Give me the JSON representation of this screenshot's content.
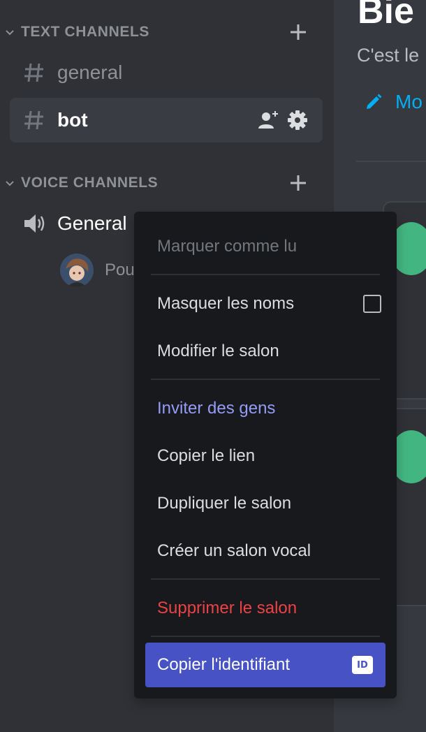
{
  "sidebar": {
    "text_category": {
      "label": "TEXT CHANNELS",
      "chevron_icon": "chevron-down-icon",
      "add_icon": "plus-icon"
    },
    "voice_category": {
      "label": "VOICE CHANNELS",
      "chevron_icon": "chevron-down-icon",
      "add_icon": "plus-icon"
    },
    "text_channels": [
      {
        "name": "general",
        "icon": "hashtag-icon",
        "selected": false
      },
      {
        "name": "bot",
        "icon": "hashtag-icon",
        "selected": true,
        "actions": [
          "add-member-icon",
          "gear-icon"
        ]
      }
    ],
    "voice_channels": [
      {
        "name": "General",
        "icon": "speaker-icon",
        "users": [
          {
            "name": "Pou",
            "avatar": "user-avatar"
          }
        ]
      }
    ]
  },
  "main": {
    "title": "Bie",
    "subtitle": "C'est le",
    "edit_link": "Mo",
    "edit_icon": "pencil-icon"
  },
  "context_menu": {
    "items": [
      {
        "label": "Marquer comme lu",
        "state": "disabled"
      },
      {
        "label": "Masquer les noms",
        "control": "checkbox",
        "checked": false
      },
      {
        "label": "Modifier le salon"
      },
      {
        "label": "Inviter des gens",
        "tone": "brand"
      },
      {
        "label": "Copier le lien"
      },
      {
        "label": "Dupliquer le salon"
      },
      {
        "label": "Créer un salon vocal"
      },
      {
        "label": "Supprimer le salon",
        "tone": "danger"
      },
      {
        "label": "Copier l'identifiant",
        "state": "focused",
        "badge": "ID"
      }
    ]
  },
  "colors": {
    "sidebar_bg": "#2f3136",
    "main_bg": "#36393f",
    "menu_bg": "#18191c",
    "selected_channel_bg": "#393c43",
    "brand": "#949cf7",
    "focused_item": "#4752c4",
    "danger": "#ed4245",
    "link": "#00aff4",
    "online": "#43b581"
  }
}
